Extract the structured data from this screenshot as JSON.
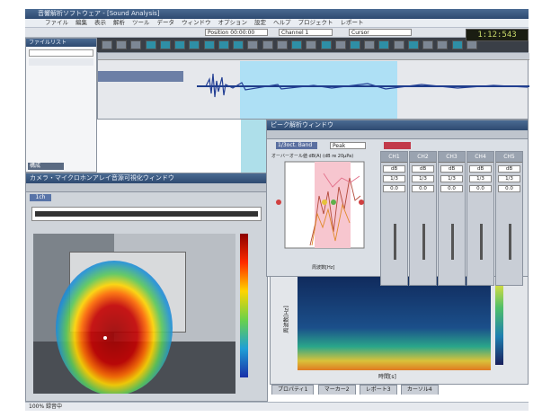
{
  "app": {
    "title": "音響解析ソフトウェア - [Sound Analysis]",
    "menu": [
      "ファイル",
      "編集",
      "表示",
      "解析",
      "ツール",
      "データ",
      "ウィンドウ",
      "オプション",
      "設定",
      "ヘルプ",
      "プロジェクト",
      "レポート"
    ],
    "toolbar_fields": [
      "Position  00:00:00",
      "Channel 1",
      "Cursor"
    ],
    "lcd": "1:12:543"
  },
  "left_panel": {
    "title": "ファイルリスト",
    "items": [
      "",
      "",
      ""
    ],
    "label": "構成"
  },
  "video_window": {
    "title": "カメラ・マイクロホンアレイ音源可視化ウィンドウ",
    "tab": "1ch",
    "colorbar": [
      "#8b0000",
      "#ff2a00",
      "#ffd400",
      "#6ad14a",
      "#1e9fd6",
      "#1a2fa8"
    ]
  },
  "analysis_window": {
    "title": "ピーク解析ウィンドウ",
    "fields": [
      "1/3oct. Band",
      "Peak"
    ],
    "plot_title": "オーバーオール値 dB(A) (dB re 20µPa)",
    "xlabel": "周波数[Hz]",
    "columns": [
      {
        "head": "CH1",
        "values": [
          "dB",
          "1/3",
          "0.0"
        ]
      },
      {
        "head": "CH2",
        "values": [
          "dB",
          "1/3",
          "0.0"
        ]
      },
      {
        "head": "CH3",
        "values": [
          "dB",
          "1/3",
          "0.0"
        ]
      },
      {
        "head": "CH4",
        "values": [
          "dB",
          "1/3",
          "0.0"
        ]
      },
      {
        "head": "CH5",
        "values": [
          "dB",
          "1/3",
          "0.0"
        ]
      }
    ]
  },
  "spectrogram": {
    "ylabel": "周波数[Hz]",
    "xlabel": "時間[s]"
  },
  "bottom_tabs": [
    "プロパティ1",
    "マーカー2",
    "レポート3",
    "カーソル4"
  ],
  "status": "100% 録音中"
}
